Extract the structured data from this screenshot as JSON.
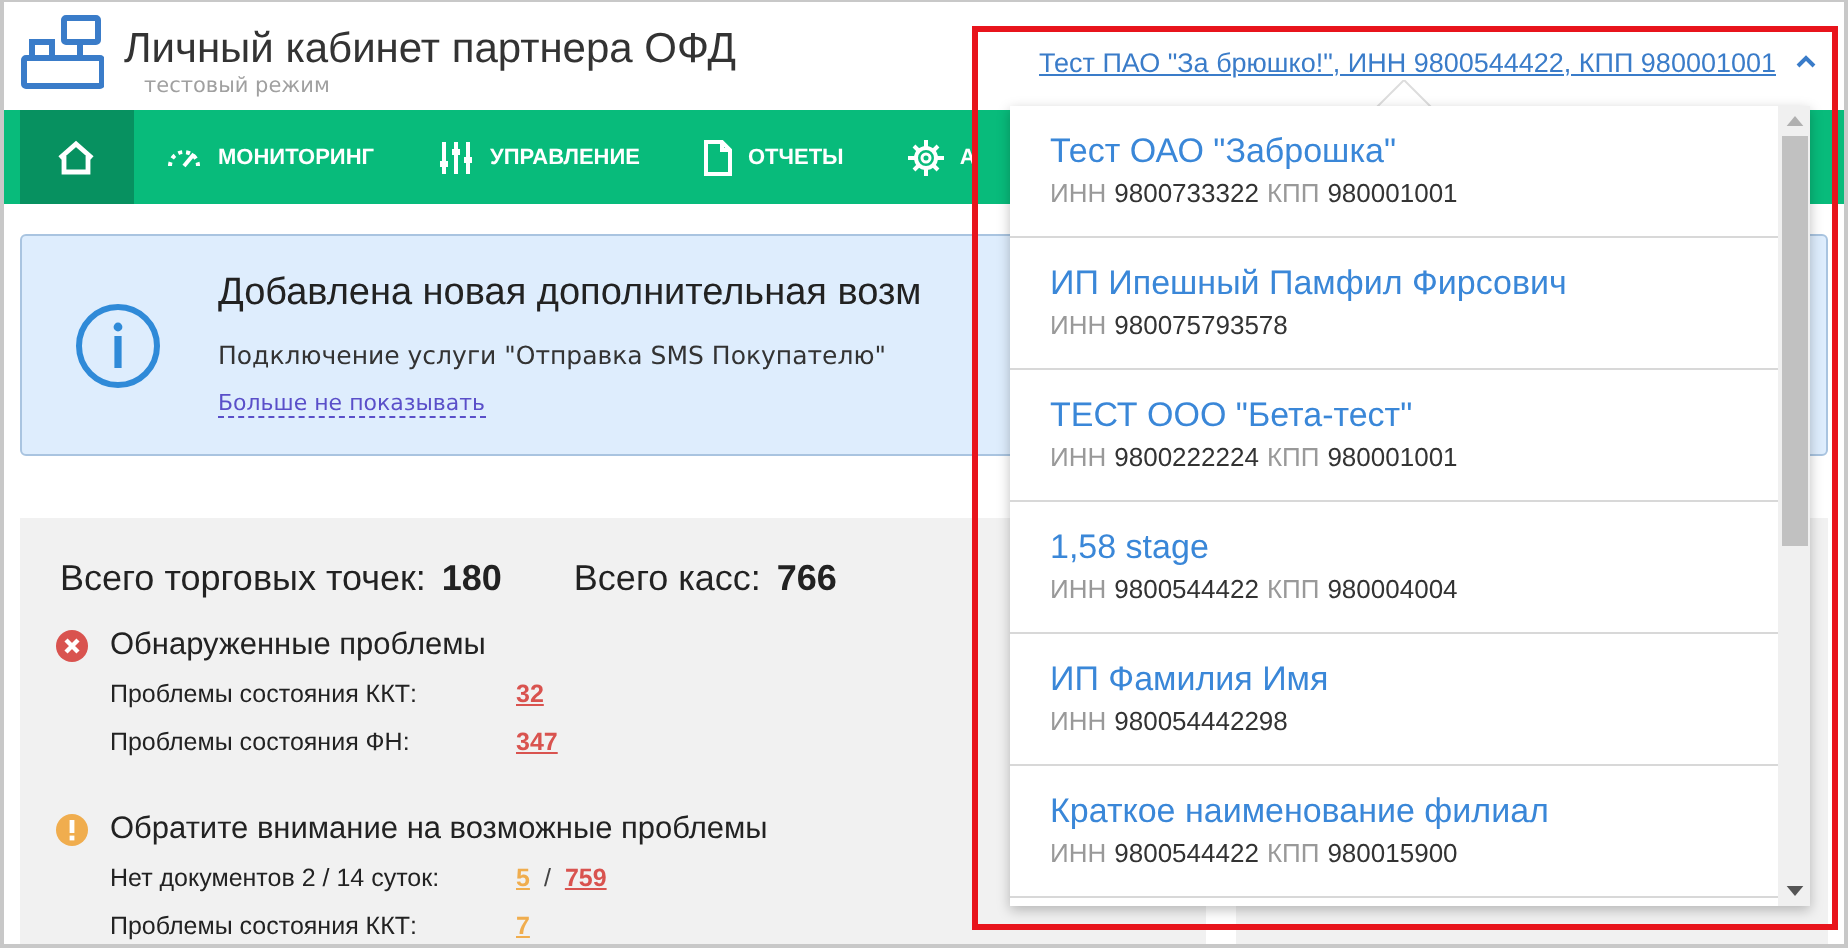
{
  "header": {
    "title": "Личный кабинет партнера ОФД",
    "subtitle": "тестовый режим",
    "account_link": "Тест ПАО \"За брюшко!\", ИНН 9800544422, КПП 980001001",
    "account_expanded": true
  },
  "nav": [
    {
      "selected": true
    },
    {
      "label": "МОНИТОРИНГ",
      "selected": false
    },
    {
      "label": "УПРАВЛЕНИЕ",
      "selected": false
    },
    {
      "label": "ОТЧЕТЫ",
      "selected": false
    },
    {
      "label": "А",
      "selected": false
    }
  ],
  "banner": {
    "title": "Добавлена новая дополнительная возм",
    "text": "Подключение услуги \"Отправка SMS Покупателю\"",
    "dismiss_link": "Больше не показывать"
  },
  "summary": {
    "totals": [
      {
        "label": "Всего торговых точек:",
        "value": "180"
      },
      {
        "label": "Всего касс:",
        "value": "766"
      }
    ],
    "sections": [
      {
        "kind": "error",
        "title": "Обнаруженные проблемы",
        "rows": [
          {
            "label": "Проблемы состояния ККТ:",
            "values": [
              {
                "text": "32",
                "color": "#d9534f"
              }
            ]
          },
          {
            "label": "Проблемы состояния ФН:",
            "values": [
              {
                "text": "347",
                "color": "#d9534f"
              }
            ]
          }
        ]
      },
      {
        "kind": "warning",
        "title": "Обратите внимание на возможные проблемы",
        "rows": [
          {
            "label": "Нет документов 2 / 14 суток:",
            "separator": "/",
            "values": [
              {
                "text": "5",
                "color": "#f0ad4e"
              },
              {
                "text": "759",
                "color": "#d9534f"
              }
            ]
          },
          {
            "label": "Проблемы состояния ККТ:",
            "values": [
              {
                "text": "7",
                "color": "#f0ad4e"
              }
            ]
          }
        ]
      }
    ]
  },
  "account_dropdown": {
    "items": [
      {
        "name": "Тест ОАО \"Заброшка\"",
        "details": [
          {
            "label": "ИНН",
            "value": "9800733322"
          },
          {
            "label": "КПП",
            "value": "980001001"
          }
        ]
      },
      {
        "name": "ИП Ипешный Памфил Фирсович",
        "details": [
          {
            "label": "ИНН",
            "value": "980075793578"
          }
        ]
      },
      {
        "name": "ТЕСТ ООО \"Бета-тест\"",
        "details": [
          {
            "label": "ИНН",
            "value": "9800222224"
          },
          {
            "label": "КПП",
            "value": "980001001"
          }
        ]
      },
      {
        "name": "1,58 stage",
        "details": [
          {
            "label": "ИНН",
            "value": "9800544422"
          },
          {
            "label": "КПП",
            "value": "980004004"
          }
        ]
      },
      {
        "name": "ИП Фамилия Имя",
        "details": [
          {
            "label": "ИНН",
            "value": "980054442298"
          }
        ]
      },
      {
        "name": "Краткое наименование филиал",
        "details": [
          {
            "label": "ИНН",
            "value": "9800544422"
          },
          {
            "label": "КПП",
            "value": "980015900"
          }
        ]
      }
    ]
  }
}
